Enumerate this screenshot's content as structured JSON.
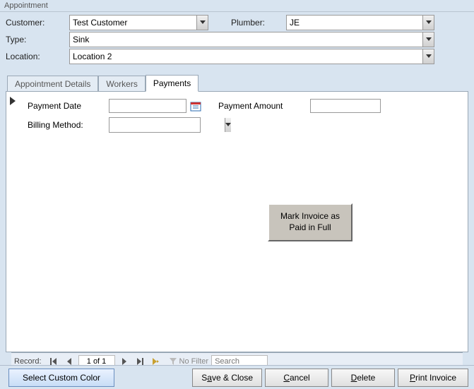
{
  "window": {
    "title": "Appointment"
  },
  "form": {
    "customer_label": "Customer:",
    "customer_value": "Test Customer",
    "plumber_label": "Plumber:",
    "plumber_value": "JE",
    "type_label": "Type:",
    "type_value": "Sink",
    "location_label": "Location:",
    "location_value": "Location 2"
  },
  "tabs": {
    "t0": "Appointment Details",
    "t1": "Workers",
    "t2": "Payments",
    "active_index": 2
  },
  "panel": {
    "payment_date_label": "Payment Date",
    "payment_date_value": "",
    "payment_amount_label": "Payment Amount",
    "payment_amount_value": "",
    "billing_method_label": "Billing Method:",
    "billing_method_value": "",
    "mark_paid_label": "Mark Invoice as Paid in Full"
  },
  "nav": {
    "label": "Record:",
    "counter": "1 of 1",
    "filter_label": "No Filter",
    "search_placeholder": "Search"
  },
  "footer": {
    "select_color": "Select Custom Color",
    "save_close_pre": "S",
    "save_close_u": "a",
    "save_close_post": "ve & Close",
    "cancel_u": "C",
    "cancel_post": "ancel",
    "delete_u": "D",
    "delete_post": "elete",
    "print_u": "P",
    "print_post": "rint Invoice"
  }
}
